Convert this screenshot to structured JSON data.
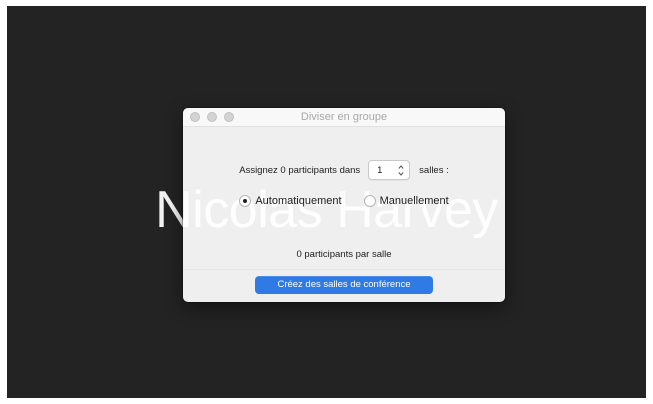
{
  "video": {
    "participant_name": "Nicolas Harvey"
  },
  "dialog": {
    "title": "Diviser en groupe",
    "assign_prefix": "Assignez 0 participants dans",
    "room_count": "1",
    "assign_suffix": "salles :",
    "radio_options": [
      {
        "label": "Automatiquement",
        "selected": true
      },
      {
        "label": "Manuellement",
        "selected": false
      }
    ],
    "per_room_text": "0 participants par salle",
    "create_button_label": "Créez des salles de conférence"
  },
  "colors": {
    "screen_background": "#232323",
    "button_primary": "#2f7ae5"
  }
}
